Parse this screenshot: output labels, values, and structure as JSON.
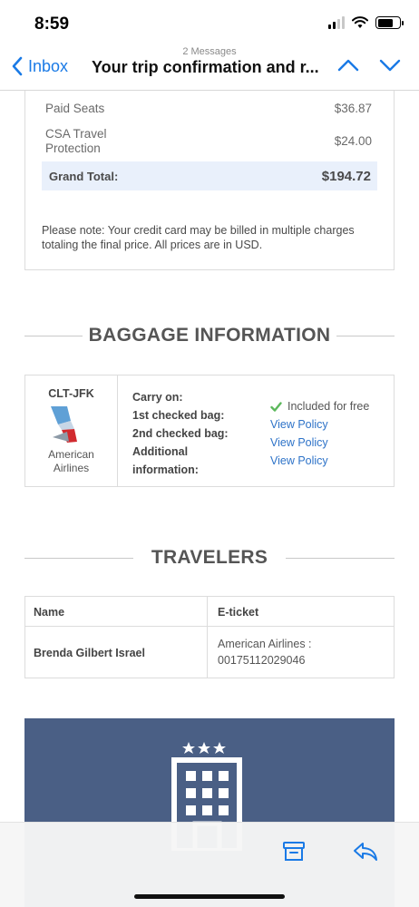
{
  "status_bar": {
    "time": "8:59"
  },
  "nav": {
    "back_label": "Inbox",
    "message_count": "2 Messages",
    "subject": "Your trip confirmation and r..."
  },
  "pricing": {
    "rows": [
      {
        "label": "Paid Seats",
        "amount": "$36.87"
      },
      {
        "label": "CSA Travel\nProtection",
        "amount": "$24.00"
      }
    ],
    "total_label": "Grand Total:",
    "total_amount": "$194.72",
    "note": "Please note: Your credit card may be billed in multiple charges totaling the final price. All prices are in USD."
  },
  "baggage": {
    "title": "BAGGAGE INFORMATION",
    "route": "CLT-JFK",
    "airline": "American\nAirlines",
    "labels": [
      "Carry on:",
      "1st checked bag:",
      "2nd checked bag:",
      "Additional",
      "information:"
    ],
    "included_text": "Included for free",
    "policy_links": [
      "View Policy",
      "View Policy",
      "View Policy"
    ]
  },
  "travelers": {
    "title": "TRAVELERS",
    "col_name": "Name",
    "col_ticket": "E-ticket",
    "name": "Brenda Gilbert Israel",
    "ticket": "American Airlines :\n00175112029046"
  },
  "colors": {
    "link_blue": "#1a7ae6",
    "banner_blue": "#4a5f85",
    "total_bg": "#e9f0fb",
    "check_green": "#5cb85c"
  },
  "icons": [
    "chevron-left-icon",
    "chevron-up-icon",
    "chevron-down-icon",
    "checkmark-icon",
    "hotel-building-icon",
    "archive-icon",
    "reply-icon"
  ]
}
